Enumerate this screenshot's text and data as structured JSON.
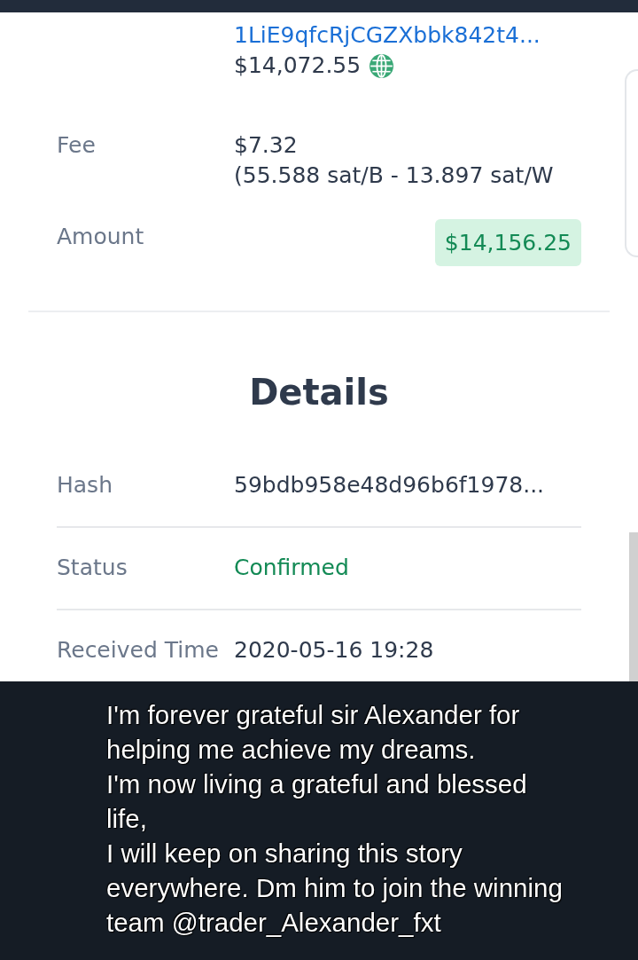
{
  "transaction": {
    "recipient": {
      "address": "1LiE9qfcRjCGZXbbk842t4...",
      "value": "$14,072.55"
    },
    "fee": {
      "label": "Fee",
      "value": "$7.32",
      "rate": "(55.588 sat/B - 13.897 sat/W"
    },
    "amount": {
      "label": "Amount",
      "value": "$14,156.25"
    }
  },
  "details": {
    "title": "Details",
    "rows": [
      {
        "label": "Hash",
        "value": "59bdb958e48d96b6f1978...",
        "kind": "plain"
      },
      {
        "label": "Status",
        "value": "Confirmed",
        "kind": "status"
      },
      {
        "label": "Received Time",
        "value": "2020-05-16 19:28",
        "kind": "plain"
      }
    ]
  },
  "caption": {
    "paragraphs": [
      "I'm forever grateful sir Alexander for helping me achieve my dreams.",
      "I'm now living a grateful and blessed life,",
      "I will keep on sharing this story everywhere. Dm him to join the winning team @trader_Alexander_fxt"
    ]
  }
}
